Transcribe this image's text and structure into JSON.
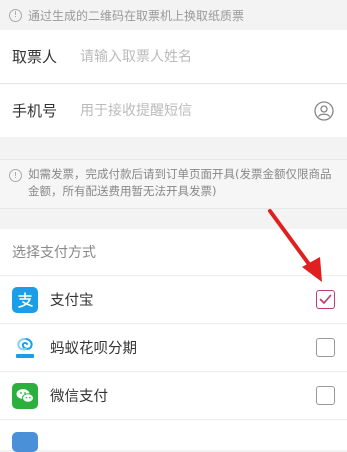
{
  "top_notice": {
    "text": "通过生成的二维码在取票机上换取纸质票"
  },
  "form": {
    "name": {
      "label": "取票人",
      "placeholder": "请输入取票人姓名"
    },
    "phone": {
      "label": "手机号",
      "placeholder": "用于接收提醒短信"
    }
  },
  "invoice_note": {
    "text": "如需发票，完成付款后请到订单页面开具(发票金额仅限商品金额，所有配送费用暂无法开具发票)"
  },
  "payment": {
    "header": "选择支付方式",
    "methods": [
      {
        "label": "支付宝",
        "icon": "alipay-icon",
        "checked": true,
        "color": "#1a9fe6"
      },
      {
        "label": "蚂蚁花呗分期",
        "icon": "huabei-icon",
        "checked": false,
        "color": "#1a9fe6"
      },
      {
        "label": "微信支付",
        "icon": "wechat-pay-icon",
        "checked": false,
        "color": "#2bb03e"
      }
    ]
  },
  "colors": {
    "checked_accent": "#c0397a",
    "annotation_arrow": "#e02020"
  }
}
